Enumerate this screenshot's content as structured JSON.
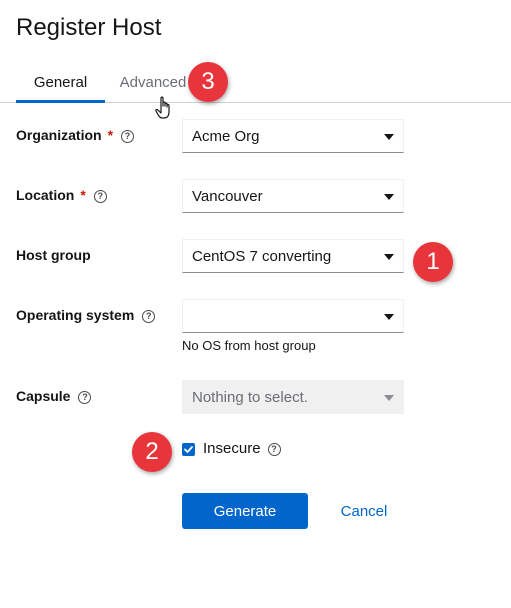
{
  "page": {
    "title": "Register Host"
  },
  "tabs": [
    {
      "label": "General",
      "active": true
    },
    {
      "label": "Advanced",
      "active": false
    }
  ],
  "form": {
    "organization": {
      "label": "Organization",
      "required_mark": "*",
      "value": "Acme Org"
    },
    "location": {
      "label": "Location",
      "required_mark": "*",
      "value": "Vancouver"
    },
    "host_group": {
      "label": "Host group",
      "value": "CentOS 7 converting"
    },
    "operating_system": {
      "label": "Operating system",
      "value": "",
      "helper": "No OS from host group"
    },
    "capsule": {
      "label": "Capsule",
      "value": "Nothing to select.",
      "disabled": true
    },
    "insecure": {
      "label": "Insecure",
      "checked": true
    }
  },
  "buttons": {
    "generate": "Generate",
    "cancel": "Cancel"
  },
  "annotations": {
    "badge1": "1",
    "badge2": "2",
    "badge3": "3"
  },
  "icons": {
    "help": "help-circle-icon",
    "caret": "caret-down-icon",
    "check": "check-icon",
    "cursor": "hand-pointer-icon"
  },
  "colors": {
    "accent": "#0066cc",
    "required": "#c9190b",
    "badge": "#e8353b"
  }
}
